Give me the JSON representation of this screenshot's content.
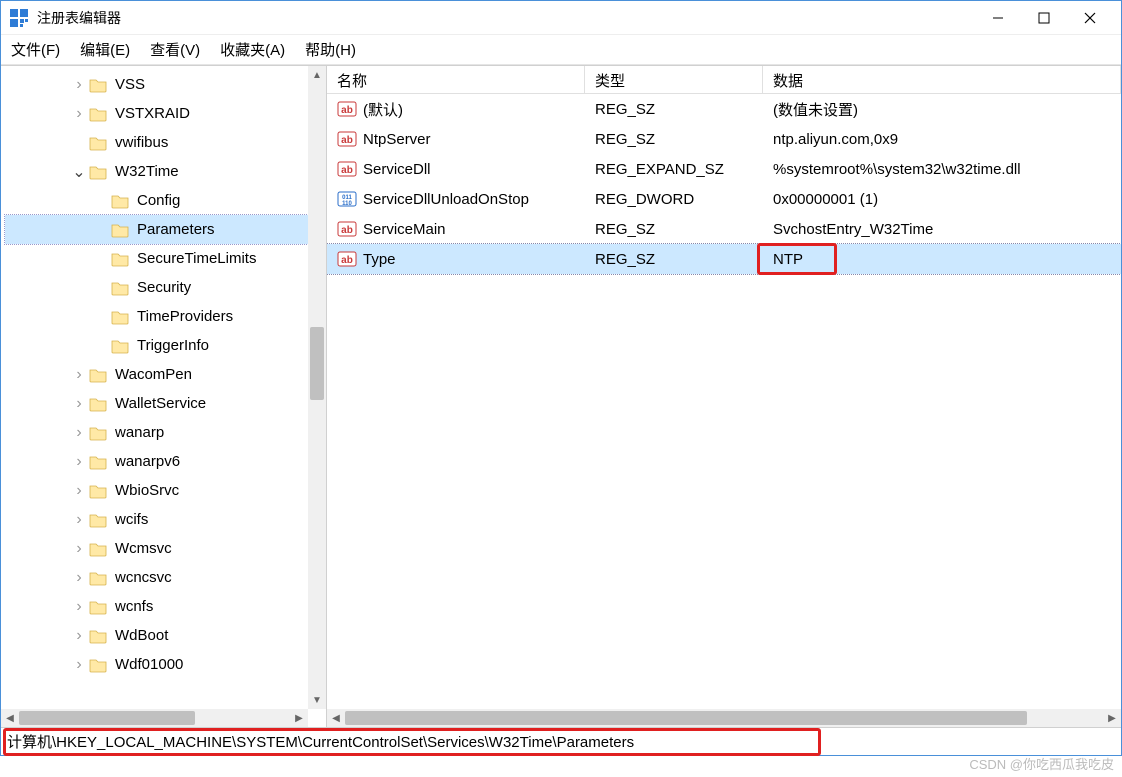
{
  "window": {
    "title": "注册表编辑器"
  },
  "menu": {
    "file": "文件(F)",
    "edit": "编辑(E)",
    "view": "查看(V)",
    "favorites": "收藏夹(A)",
    "help": "帮助(H)"
  },
  "tree": [
    {
      "indent": 3,
      "exp": "r",
      "label": "VSS"
    },
    {
      "indent": 3,
      "exp": "r",
      "label": "VSTXRAID"
    },
    {
      "indent": 3,
      "exp": "",
      "label": "vwifibus"
    },
    {
      "indent": 3,
      "exp": "d",
      "label": "W32Time"
    },
    {
      "indent": 4,
      "exp": "",
      "label": "Config"
    },
    {
      "indent": 4,
      "exp": "",
      "label": "Parameters",
      "selected": true
    },
    {
      "indent": 4,
      "exp": "",
      "label": "SecureTimeLimits"
    },
    {
      "indent": 4,
      "exp": "",
      "label": "Security"
    },
    {
      "indent": 4,
      "exp": "",
      "label": "TimeProviders"
    },
    {
      "indent": 4,
      "exp": "",
      "label": "TriggerInfo"
    },
    {
      "indent": 3,
      "exp": "r",
      "label": "WacomPen"
    },
    {
      "indent": 3,
      "exp": "r",
      "label": "WalletService"
    },
    {
      "indent": 3,
      "exp": "r",
      "label": "wanarp"
    },
    {
      "indent": 3,
      "exp": "r",
      "label": "wanarpv6"
    },
    {
      "indent": 3,
      "exp": "r",
      "label": "WbioSrvc"
    },
    {
      "indent": 3,
      "exp": "r",
      "label": "wcifs"
    },
    {
      "indent": 3,
      "exp": "r",
      "label": "Wcmsvc"
    },
    {
      "indent": 3,
      "exp": "r",
      "label": "wcncsvc"
    },
    {
      "indent": 3,
      "exp": "r",
      "label": "wcnfs"
    },
    {
      "indent": 3,
      "exp": "r",
      "label": "WdBoot"
    },
    {
      "indent": 3,
      "exp": "r",
      "label": "Wdf01000"
    }
  ],
  "columns": {
    "name": "名称",
    "type": "类型",
    "data": "数据"
  },
  "values": [
    {
      "icon": "sz",
      "name": "(默认)",
      "type": "REG_SZ",
      "data": "(数值未设置)"
    },
    {
      "icon": "sz",
      "name": "NtpServer",
      "type": "REG_SZ",
      "data": "ntp.aliyun.com,0x9"
    },
    {
      "icon": "sz",
      "name": "ServiceDll",
      "type": "REG_EXPAND_SZ",
      "data": "%systemroot%\\system32\\w32time.dll"
    },
    {
      "icon": "bin",
      "name": "ServiceDllUnloadOnStop",
      "type": "REG_DWORD",
      "data": "0x00000001 (1)"
    },
    {
      "icon": "sz",
      "name": "ServiceMain",
      "type": "REG_SZ",
      "data": "SvchostEntry_W32Time"
    },
    {
      "icon": "sz",
      "name": "Type",
      "type": "REG_SZ",
      "data": "NTP",
      "selected": true,
      "highlight": true
    }
  ],
  "status": {
    "path": "计算机\\HKEY_LOCAL_MACHINE\\SYSTEM\\CurrentControlSet\\Services\\W32Time\\Parameters"
  },
  "watermark": "CSDN @你吃西瓜我吃皮"
}
